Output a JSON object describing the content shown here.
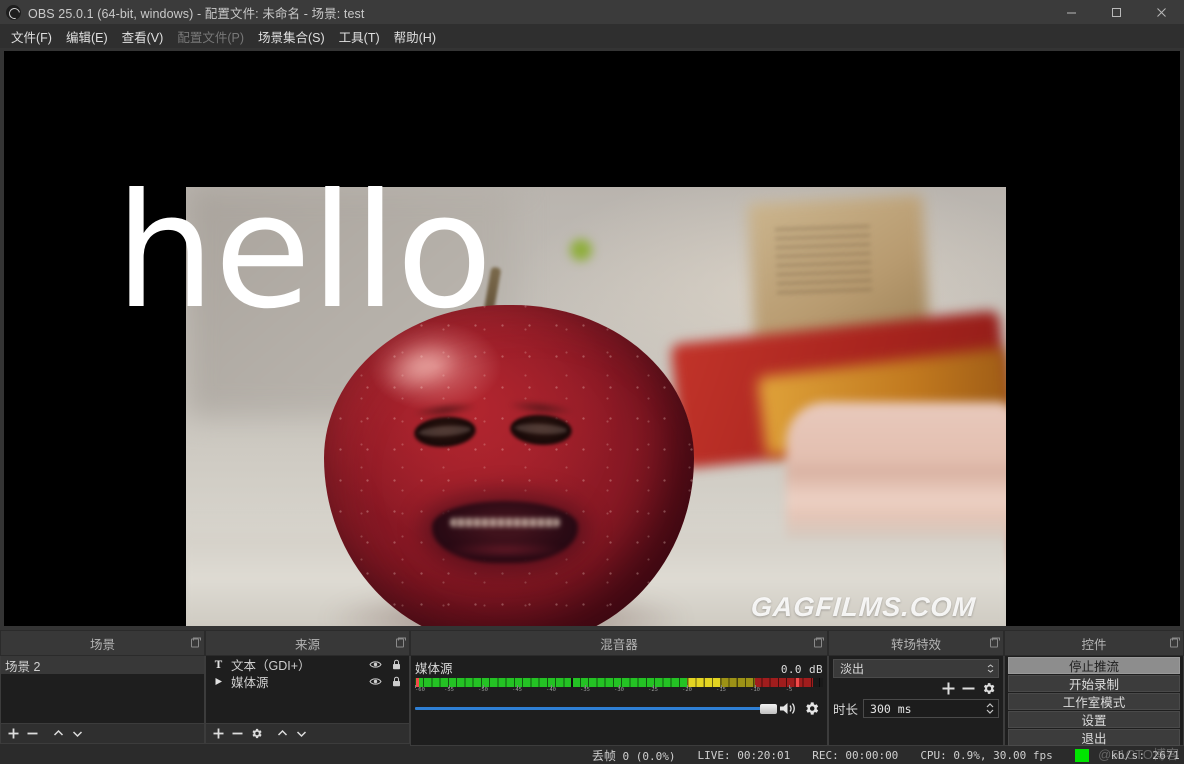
{
  "window": {
    "title": "OBS 25.0.1 (64-bit, windows) - 配置文件: 未命名 - 场景: test",
    "minimize_icon": "minimize-icon",
    "maximize_icon": "maximize-icon",
    "close_icon": "close-icon"
  },
  "menubar": {
    "items": [
      {
        "label": "文件(F)",
        "disabled": false
      },
      {
        "label": "编辑(E)",
        "disabled": false
      },
      {
        "label": "查看(V)",
        "disabled": false
      },
      {
        "label": "配置文件(P)",
        "disabled": true
      },
      {
        "label": "场景集合(S)",
        "disabled": false
      },
      {
        "label": "工具(T)",
        "disabled": false
      },
      {
        "label": "帮助(H)",
        "disabled": false
      }
    ]
  },
  "preview": {
    "overlay_text": "hello",
    "video_watermark": "GAGFILMS.COM"
  },
  "scenes": {
    "title": "场景",
    "items": [
      {
        "label": "场景 2",
        "selected": true
      }
    ],
    "toolbar": [
      {
        "name": "add-scene-button",
        "glyph": "+"
      },
      {
        "name": "remove-scene-button",
        "glyph": "−"
      },
      {
        "name": "move-scene-up-button",
        "glyph": "^"
      },
      {
        "name": "move-scene-down-button",
        "glyph": "v"
      }
    ]
  },
  "sources": {
    "title": "来源",
    "items": [
      {
        "label": "文本（GDI+）",
        "icon": "text-source-icon",
        "visible": true,
        "locked": true
      },
      {
        "label": "媒体源",
        "icon": "media-source-icon",
        "visible": true,
        "locked": true
      }
    ],
    "toolbar": [
      {
        "name": "add-source-button",
        "glyph": "+"
      },
      {
        "name": "remove-source-button",
        "glyph": "−"
      },
      {
        "name": "source-properties-button",
        "glyph": "gear"
      },
      {
        "name": "move-source-up-button",
        "glyph": "^"
      },
      {
        "name": "move-source-down-button",
        "glyph": "v"
      }
    ]
  },
  "mixer": {
    "title": "混音器",
    "channel_name": "媒体源",
    "db_value": "0.0 dB",
    "meter": {
      "min_db": -60,
      "max_db": 0,
      "level_db": -1.5,
      "peak_hold_db": -37,
      "ticks": [
        -60,
        -55,
        -50,
        -45,
        -40,
        -35,
        -30,
        -25,
        -20,
        -15,
        -10,
        -5
      ],
      "colors": {
        "green": "#24c224",
        "yellow": "#e3d422",
        "dark_yellow": "#9d9216",
        "red": "#a01d1d",
        "peak_red": "#f24b4b"
      }
    },
    "volume_percent": 100,
    "mute_icon": "speaker-icon",
    "settings_icon": "gear-icon"
  },
  "transitions": {
    "title": "转场特效",
    "selected_transition": "淡出",
    "duration_label": "时长",
    "duration_value": "300 ms",
    "buttons": [
      {
        "name": "add-transition-button",
        "glyph": "+"
      },
      {
        "name": "remove-transition-button",
        "glyph": "−"
      },
      {
        "name": "transition-properties-button",
        "glyph": "gear"
      }
    ]
  },
  "controls": {
    "title": "控件",
    "buttons": [
      {
        "label": "停止推流",
        "name": "stop-stream-button",
        "active": true
      },
      {
        "label": "开始录制",
        "name": "start-record-button",
        "active": false
      },
      {
        "label": "工作室模式",
        "name": "studio-mode-button",
        "active": false
      },
      {
        "label": "设置",
        "name": "settings-button",
        "active": false
      },
      {
        "label": "退出",
        "name": "exit-button",
        "active": false
      }
    ]
  },
  "statusbar": {
    "dropped_frames_label": "丢帧",
    "dropped_frames_value": "0 (0.0%)",
    "live_label": "LIVE:",
    "live_value": "00:20:01",
    "rec_label": "REC:",
    "rec_value": "00:00:00",
    "cpu_text": "CPU: 0.9%, 30.00 fps",
    "bitrate_text": "kb/s: 2671",
    "network_status_color": "#00e500"
  },
  "watermark": "@51CTO博客"
}
